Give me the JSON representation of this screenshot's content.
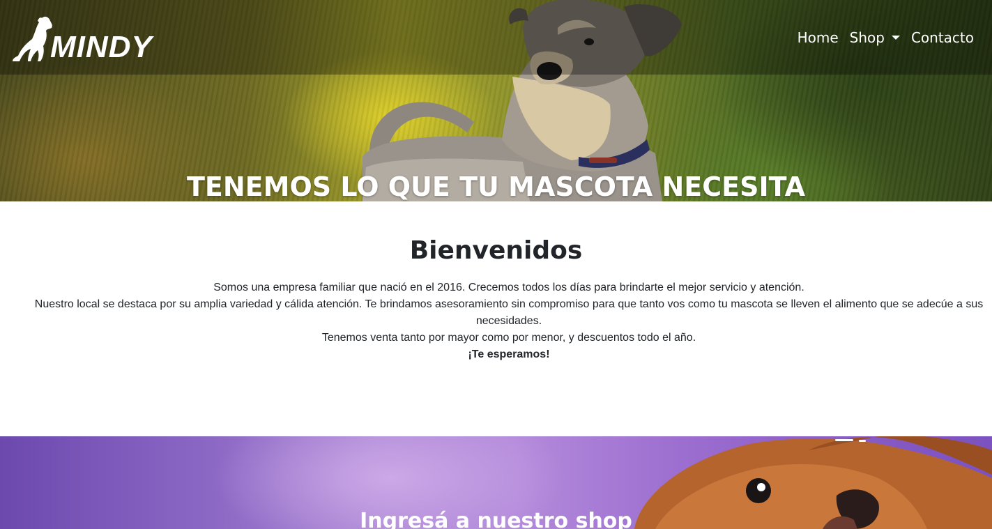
{
  "navbar": {
    "brand": "MINDY",
    "links": [
      {
        "label": "Home"
      },
      {
        "label": "Shop",
        "dropdown": true
      },
      {
        "label": "Contacto"
      }
    ]
  },
  "hero": {
    "title": "TENEMOS LO QUE TU MASCOTA NECESITA"
  },
  "welcome": {
    "title": "Bienvenidos",
    "line1": "Somos una empresa familiar que nació en el 2016. Crecemos todos los días para brindarte el mejor servicio y atención.",
    "line2": "Nuestro local se destaca por su amplia variedad y cálida atención. Te brindamos asesoramiento sin compromiso para que tanto vos como tu mascota se lleven el alimento que se adecúe a sus necesidades.",
    "line3": "Tenemos venta tanto por mayor como por menor, y descuentos todo el año.",
    "closing": "¡Te esperamos!"
  },
  "shop_banner": {
    "title": "Ingresá a nuestro shop"
  },
  "colors": {
    "banner_purple": "#9d6fd0",
    "text_dark": "#212529",
    "navbar_overlay": "rgba(0,0,0,0.32)"
  }
}
